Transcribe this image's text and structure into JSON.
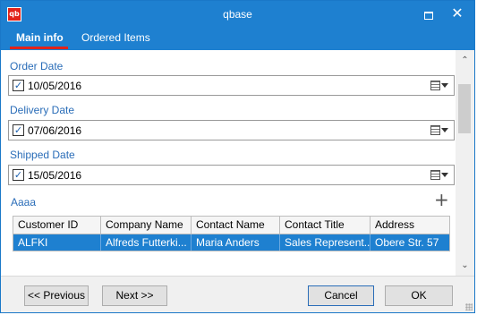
{
  "window": {
    "title": "qbase",
    "icon_text": "qb",
    "icon_name": "qbase-app-icon",
    "maximize_icon": "maximize-icon",
    "close_icon": "close-icon",
    "close_glyph": "✕"
  },
  "tabs": [
    {
      "label": "Main info",
      "active": true
    },
    {
      "label": "Ordered Items",
      "active": false
    }
  ],
  "fields": {
    "order_date": {
      "label": "Order Date",
      "value": "10/05/2016",
      "checked": true
    },
    "delivery_date": {
      "label": "Delivery Date",
      "value": "07/06/2016",
      "checked": true
    },
    "shipped_date": {
      "label": "Shipped Date",
      "value": "15/05/2016",
      "checked": true
    }
  },
  "section": {
    "label": "Aaaa",
    "add_glyph": "+",
    "add_icon": "plus-icon"
  },
  "grid": {
    "columns": [
      "Customer ID",
      "Company Name",
      "Contact Name",
      "Contact Title",
      "Address"
    ],
    "rows": [
      [
        "ALFKI",
        "Alfreds Futterki...",
        "Maria Anders",
        "Sales Represent...",
        "Obere Str. 57"
      ]
    ],
    "selected_row": 0
  },
  "scrollbar": {
    "up_glyph": "⌃",
    "down_glyph": "⌄"
  },
  "footer": {
    "previous_label": "<< Previous",
    "next_label": "Next >>",
    "cancel_label": "Cancel",
    "ok_label": "OK"
  },
  "colors": {
    "accent": "#1e80d0",
    "tab_underline": "#e2231a",
    "label_blue": "#2a6db8",
    "selection": "#1e80d0"
  }
}
